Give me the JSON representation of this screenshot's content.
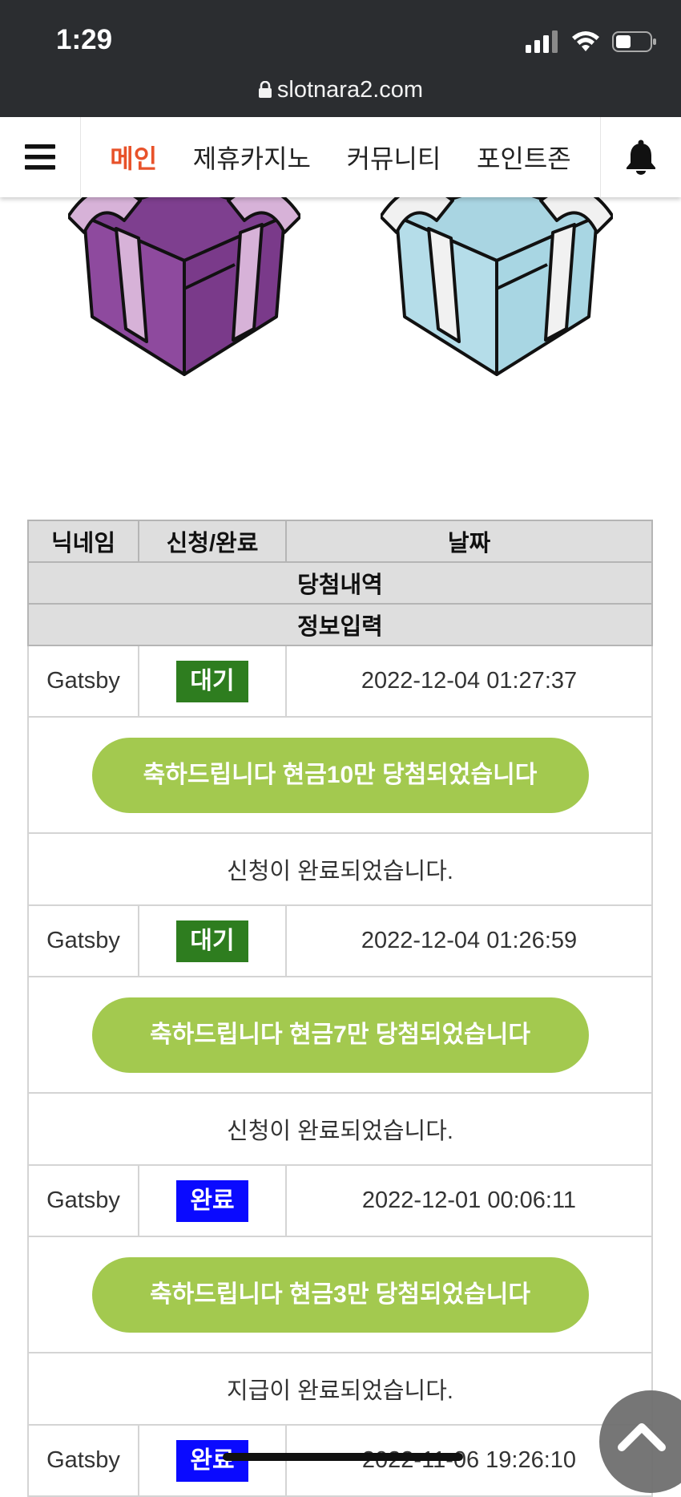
{
  "status_bar": {
    "time": "1:29",
    "url": "slotnara2.com"
  },
  "nav": {
    "items": [
      {
        "label": "메인",
        "active": true
      },
      {
        "label": "제휴카지노",
        "active": false
      },
      {
        "label": "커뮤니티",
        "active": false
      },
      {
        "label": "포인트존",
        "active": false
      }
    ],
    "accent_color": "#e8522a"
  },
  "table": {
    "headers": {
      "nickname": "닉네임",
      "apply_complete": "신청/완료",
      "date": "날짜"
    },
    "subheaders": {
      "prize_history": "당첨내역",
      "info_input": "정보입력"
    },
    "rows": [
      {
        "nickname": "Gatsby",
        "status": "대기",
        "status_color": "#2e7d1f",
        "date": "2022-12-04 01:27:37",
        "prize": "축하드립니다 현금10만 당첨되었습니다",
        "message": "신청이 완료되었습니다."
      },
      {
        "nickname": "Gatsby",
        "status": "대기",
        "status_color": "#2e7d1f",
        "date": "2022-12-04 01:26:59",
        "prize": "축하드립니다 현금7만 당첨되었습니다",
        "message": "신청이 완료되었습니다."
      },
      {
        "nickname": "Gatsby",
        "status": "완료",
        "status_color": "#0a0aff",
        "date": "2022-12-01 00:06:11",
        "prize": "축하드립니다 현금3만 당첨되었습니다",
        "message": "지급이 완료되었습니다."
      },
      {
        "nickname": "Gatsby",
        "status": "완료",
        "status_color": "#0a0aff",
        "date": "2022-11-06 19:26:10"
      }
    ]
  },
  "prize_button_color": "#a3c94f",
  "icons": [
    "lock-icon",
    "signal-icon",
    "wifi-icon",
    "battery-icon",
    "hamburger-icon",
    "bell-icon",
    "gift-box-purple",
    "gift-box-blue",
    "chevron-up-icon"
  ]
}
